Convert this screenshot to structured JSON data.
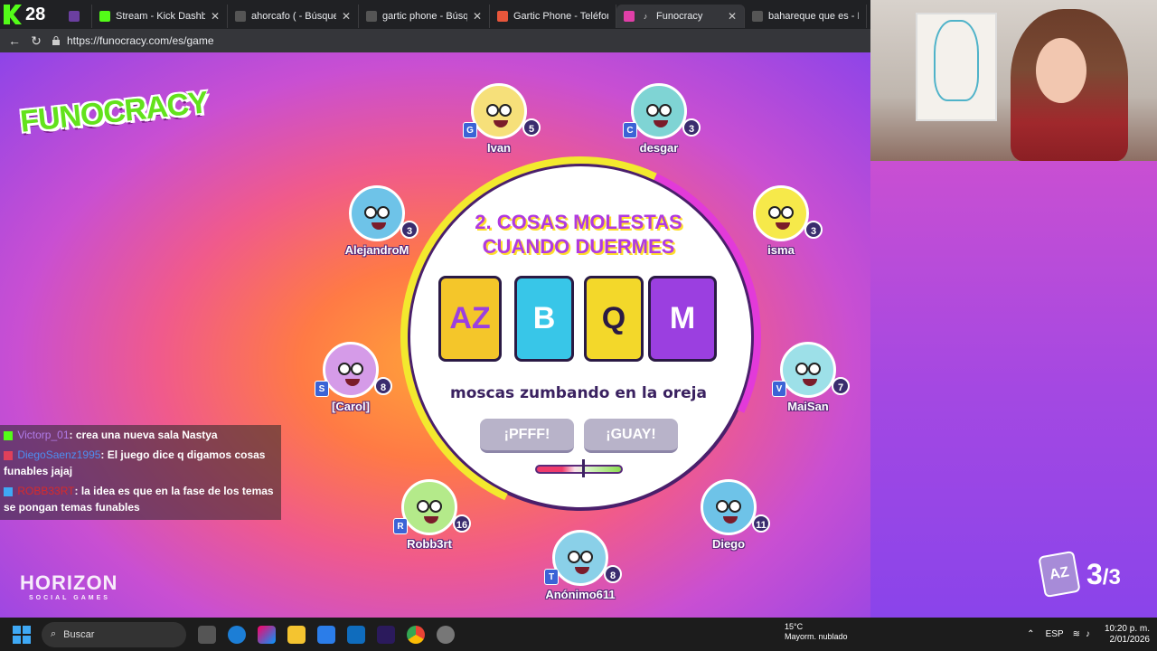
{
  "browser": {
    "tab_count": "28",
    "tabs": [
      {
        "title": "",
        "color": "#6b3fa0"
      },
      {
        "title": "Stream - Kick Dashboard",
        "color": "#53fc18"
      },
      {
        "title": "ahorcafo ( - Búsqueda",
        "color": "#555"
      },
      {
        "title": "gartic phone - Búsqueda",
        "color": "#555"
      },
      {
        "title": "Gartic Phone - Teléfono",
        "color": "#e8563b"
      },
      {
        "title": "Funocracy",
        "color": "#e03fa8"
      },
      {
        "title": "bahareque que es - Búsq",
        "color": "#555"
      }
    ],
    "url": "https://funocracy.com/es/game"
  },
  "game": {
    "logo": "FUNOCRACY",
    "question_number": "2.",
    "question_title_line1": "2. COSAS MOLESTAS",
    "question_title_line2": "CUANDO DUERMES",
    "cards": [
      {
        "label": "AZ",
        "bg": "#f4c62a"
      },
      {
        "label": "B",
        "bg": "#38c6e8"
      },
      {
        "label": "Q",
        "bg": "#f3d82a"
      },
      {
        "label": "M",
        "bg": "#9b3fe0"
      }
    ],
    "answer": "moscas zumbando en la oreja",
    "button_meh": "¡PFFF!",
    "button_yay": "¡GUAY!",
    "round_current": "3",
    "round_total": "/3",
    "round_icon": "AZ"
  },
  "players": [
    {
      "name": "Ivan",
      "score": "5",
      "badge": "G",
      "color": "#f6e07a"
    },
    {
      "name": "desgar",
      "score": "3",
      "badge": "C",
      "color": "#7fd4d4"
    },
    {
      "name": "AlejandroM",
      "score": "3",
      "badge": "",
      "color": "#6ec3e8"
    },
    {
      "name": "isma",
      "score": "3",
      "badge": "",
      "color": "#f6e94a"
    },
    {
      "name": "[Carol]",
      "score": "8",
      "badge": "S",
      "color": "#d59be8"
    },
    {
      "name": "MaiSan",
      "score": "7",
      "badge": "V",
      "color": "#9de0e8"
    },
    {
      "name": "Robb3rt",
      "score": "16",
      "badge": "R",
      "color": "#b4ea8a"
    },
    {
      "name": "Diego",
      "score": "11",
      "badge": "",
      "color": "#6ec3e8"
    },
    {
      "name": "Anónimo611",
      "score": "8",
      "badge": "T",
      "color": "#8ad0e8"
    }
  ],
  "chat": [
    {
      "user": "Victorp_01",
      "user_color": "#b07be8",
      "text": ": crea una nueva sala Nastya"
    },
    {
      "user": "DiegoSaenz1995",
      "user_color": "#4d8ef0",
      "text": ": El juego dice q digamos cosas funables jajaj"
    },
    {
      "user": "ROBB33RT",
      "user_color": "#d62b2b",
      "text": ": la idea es que en la fase de los temas se pongan temas funables"
    }
  ],
  "sponsor": {
    "name": "HORIZON",
    "tagline": "SOCIAL GAMES"
  },
  "taskbar": {
    "search_placeholder": "Buscar",
    "weather_temp": "15°C",
    "weather_desc": "Mayorm. nublado",
    "language": "ESP",
    "time": "10:20 p. m.",
    "date": "2/01/2026"
  }
}
